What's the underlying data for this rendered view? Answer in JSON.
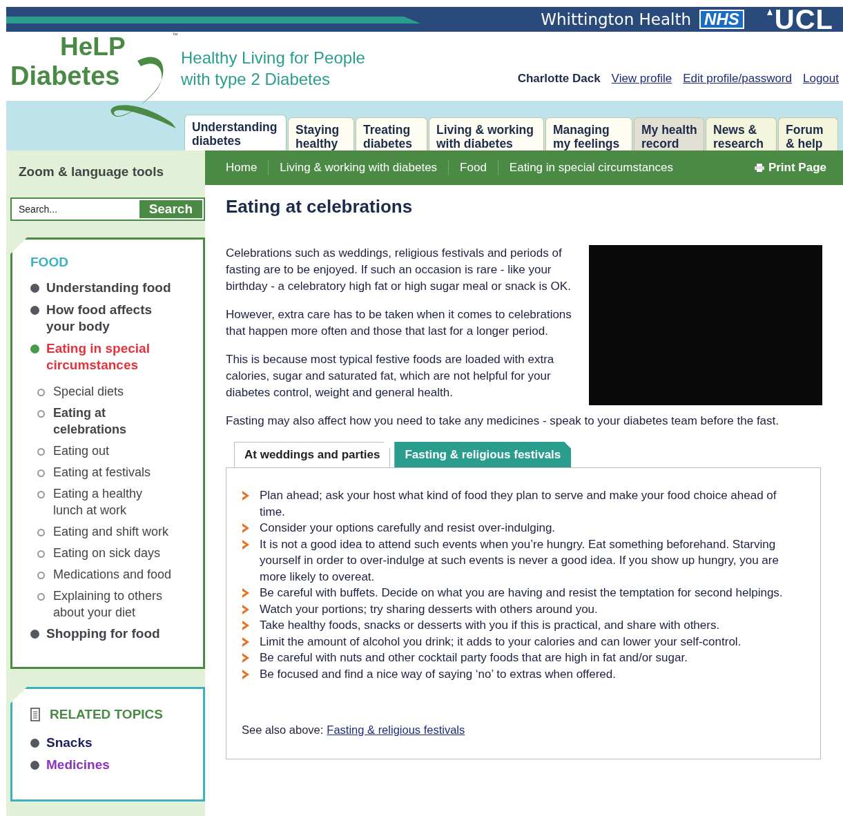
{
  "banner": {
    "partner": "Whittington Health",
    "nhs": "NHS",
    "ucl": "UCL"
  },
  "logo": {
    "line1": "HeLP",
    "line2": "Diabetes",
    "tm": "™"
  },
  "tagline": [
    "Healthy Living for People",
    "with type 2 Diabetes"
  ],
  "user": {
    "name": "Charlotte Dack",
    "links": [
      "View profile",
      "Edit profile/password",
      "Logout"
    ]
  },
  "main_tabs": [
    {
      "label": "Understanding diabetes",
      "selected": true,
      "color": "#ffffff"
    },
    {
      "label": "Staying healthy",
      "selected": false,
      "color": "#fdfdf3"
    },
    {
      "label": "Treating diabetes",
      "selected": false,
      "color": "#fdfdf3"
    },
    {
      "label": "Living & working with diabetes",
      "selected": false,
      "color": "#fdfdf3"
    },
    {
      "label": "Managing my feelings",
      "selected": false,
      "color": "#fdfdf3"
    },
    {
      "label": "My health record",
      "selected": false,
      "color": "#e2e0d4"
    },
    {
      "label": "News & research",
      "selected": false,
      "color": "#f2f5dc"
    },
    {
      "label": "Forum & help",
      "selected": false,
      "color": "#f2f5dc"
    }
  ],
  "sidebar": {
    "tools_title": "Zoom & language tools",
    "search": {
      "placeholder": "Search...",
      "button": "Search"
    },
    "nav": {
      "title": "FOOD",
      "items": [
        {
          "label": "Understanding food",
          "selected": false
        },
        {
          "label": "How food affects your body",
          "selected": false
        },
        {
          "label": "Eating in special circumstances",
          "selected": true,
          "children": [
            {
              "label": "Special diets",
              "selected": false
            },
            {
              "label": "Eating at celebrations",
              "selected": true
            },
            {
              "label": "Eating out",
              "selected": false
            },
            {
              "label": "Eating at festivals",
              "selected": false
            },
            {
              "label": "Eating a healthy lunch at work",
              "selected": false
            },
            {
              "label": "Eating and shift work",
              "selected": false
            },
            {
              "label": "Eating on sick days",
              "selected": false
            },
            {
              "label": "Medications and food",
              "selected": false
            },
            {
              "label": "Explaining to others about your diet",
              "selected": false
            }
          ]
        },
        {
          "label": "Shopping for food",
          "selected": false
        }
      ]
    },
    "related": {
      "title": "RELATED TOPICS",
      "items": [
        {
          "label": "Snacks",
          "visited": false
        },
        {
          "label": "Medicines",
          "visited": true
        }
      ]
    }
  },
  "breadcrumb": [
    "Home",
    "Living & working with diabetes",
    "Food",
    "Eating in special circumstances"
  ],
  "print": "Print Page",
  "page_title": "Eating at celebrations",
  "intro": [
    "Celebrations such as weddings, religious festivals and periods of fasting are to be enjoyed. If such an occasion is rare - like your birthday - a celebratory high fat or high sugar meal or snack is OK.",
    "However, extra care has to be taken when it comes to celebrations that happen more often and those that last for a longer period.",
    "This is because most typical festive foods are loaded with extra calories, sugar and saturated fat, which are not helpful for your diabetes control, weight and general health."
  ],
  "fasting_note": "Fasting may also affect how you need to take any medicines - speak to your diabetes team before the fast.",
  "content_tabs": [
    {
      "label": "At weddings and parties",
      "selected": true
    },
    {
      "label": "Fasting & religious festivals",
      "selected": false
    }
  ],
  "tips": [
    "Plan ahead; ask your host what kind of food they plan to serve and make your food choice ahead of time.",
    "Consider your options carefully and resist over-indulging.",
    "It is not a good idea to attend such events when you’re hungry. Eat something beforehand. Starving yourself in order to over-indulge at such events is never a good idea. If you show up hungry, you are more likely to overeat.",
    "Be careful with buffets. Decide on what you are having and resist the temptation for second helpings.",
    "Watch your portions; try sharing desserts with others around you.",
    "Take healthy foods, snacks or desserts with you if this is practical, and share with others.",
    "Limit the amount of alcohol you drink; it adds to your calories and can lower your self-control.",
    "Be careful with nuts and other cocktail party foods that are high in fat and/or sugar.",
    "Be focused and find a nice way of saying ‘no’ to extras when offered."
  ],
  "see_also": {
    "label": "See also above:",
    "link": "Fasting & religious festivals"
  }
}
